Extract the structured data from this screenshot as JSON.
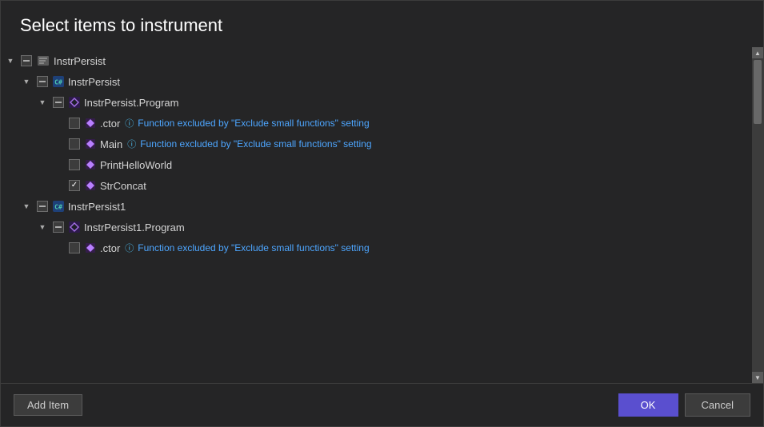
{
  "dialog": {
    "title": "Select items to instrument",
    "add_item_label": "Add Item",
    "ok_label": "OK",
    "cancel_label": "Cancel"
  },
  "tree": {
    "rows": [
      {
        "id": "row-instr-persist-assembly",
        "indent": 0,
        "expander": "▼",
        "checkbox_state": "indeterminate",
        "icon_type": "assembly",
        "label": "InstrPersist",
        "info": false,
        "excluded_text": ""
      },
      {
        "id": "row-instr-persist-project",
        "indent": 1,
        "expander": "▼",
        "checkbox_state": "indeterminate",
        "icon_type": "project",
        "label": "InstrPersist",
        "info": false,
        "excluded_text": ""
      },
      {
        "id": "row-instr-persist-program",
        "indent": 2,
        "expander": "▼",
        "checkbox_state": "indeterminate",
        "icon_type": "class",
        "label": "InstrPersist.Program",
        "info": false,
        "excluded_text": ""
      },
      {
        "id": "row-ctor-1",
        "indent": 3,
        "expander": "",
        "checkbox_state": "unchecked",
        "icon_type": "method",
        "label": ".ctor",
        "info": true,
        "excluded_text": "Function excluded by \"Exclude small functions\" setting"
      },
      {
        "id": "row-main",
        "indent": 3,
        "expander": "",
        "checkbox_state": "unchecked",
        "icon_type": "method",
        "label": "Main",
        "info": true,
        "excluded_text": "Function excluded by \"Exclude small functions\" setting"
      },
      {
        "id": "row-printhelloworld",
        "indent": 3,
        "expander": "",
        "checkbox_state": "unchecked",
        "icon_type": "method",
        "label": "PrintHelloWorld",
        "info": false,
        "excluded_text": ""
      },
      {
        "id": "row-strconcat",
        "indent": 3,
        "expander": "",
        "checkbox_state": "checked",
        "icon_type": "method",
        "label": "StrConcat",
        "info": false,
        "excluded_text": ""
      },
      {
        "id": "row-instrpersist1-project",
        "indent": 1,
        "expander": "▼",
        "checkbox_state": "indeterminate",
        "icon_type": "project",
        "label": "InstrPersist1",
        "info": false,
        "excluded_text": ""
      },
      {
        "id": "row-instrpersist1-program",
        "indent": 2,
        "expander": "▼",
        "checkbox_state": "indeterminate",
        "icon_type": "class",
        "label": "InstrPersist1.Program",
        "info": false,
        "excluded_text": ""
      },
      {
        "id": "row-ctor-2",
        "indent": 3,
        "expander": "",
        "checkbox_state": "unchecked",
        "icon_type": "method",
        "label": ".ctor",
        "info": true,
        "excluded_text": "Function excluded by \"Exclude small functions\" setting"
      }
    ]
  },
  "icons": {
    "assembly_unicode": "▤",
    "project_unicode": "C#",
    "class_unicode": "◈",
    "method_unicode": "◆",
    "info_unicode": "ⓘ",
    "checked_mark": "✓",
    "expand_down": "▼",
    "expand_right": "▶"
  }
}
